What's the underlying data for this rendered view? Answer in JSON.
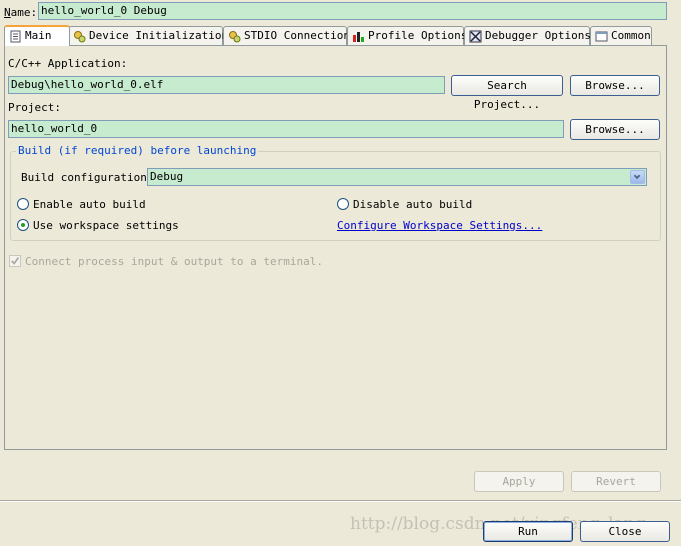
{
  "name_row": {
    "label": "Name:",
    "value": "hello_world_0 Debug"
  },
  "tabs": [
    {
      "label": "Main",
      "icon": "document-icon"
    },
    {
      "label": "Device Initialization",
      "icon": "gears-icon"
    },
    {
      "label": "STDIO Connection",
      "icon": "gears-icon"
    },
    {
      "label": "Profile Options",
      "icon": "bar-chart-icon"
    },
    {
      "label": "Debugger Options",
      "icon": "debugger-icon"
    },
    {
      "label": "Common",
      "icon": "window-icon"
    }
  ],
  "main": {
    "application_label": "C/C++ Application:",
    "application_value": "Debug\\hello_world_0.elf",
    "search_project_label": "Search Project...",
    "browse_label": "Browse...",
    "project_label": "Project:",
    "project_value": "hello_world_0",
    "project_browse_label": "Browse...",
    "build_group": {
      "title": "Build (if required) before launching",
      "config_label": "Build configuration:",
      "config_value": "Debug",
      "enable_auto_build": "Enable auto build",
      "disable_auto_build": "Disable auto build",
      "use_workspace": "Use workspace settings",
      "configure_link": "Configure Workspace Settings..."
    },
    "connect_label": "Connect process input & output to a terminal."
  },
  "bottom": {
    "apply": "Apply",
    "revert": "Revert"
  },
  "footer": {
    "run": "Run",
    "close": "Close",
    "watermark": "http://blog.csdn.net/xingfeng_lang"
  },
  "colors": {
    "field_bg": "#c7ebcf",
    "window_bg": "#ece9d8",
    "link": "#0000cc",
    "group_title": "#0046d5"
  }
}
